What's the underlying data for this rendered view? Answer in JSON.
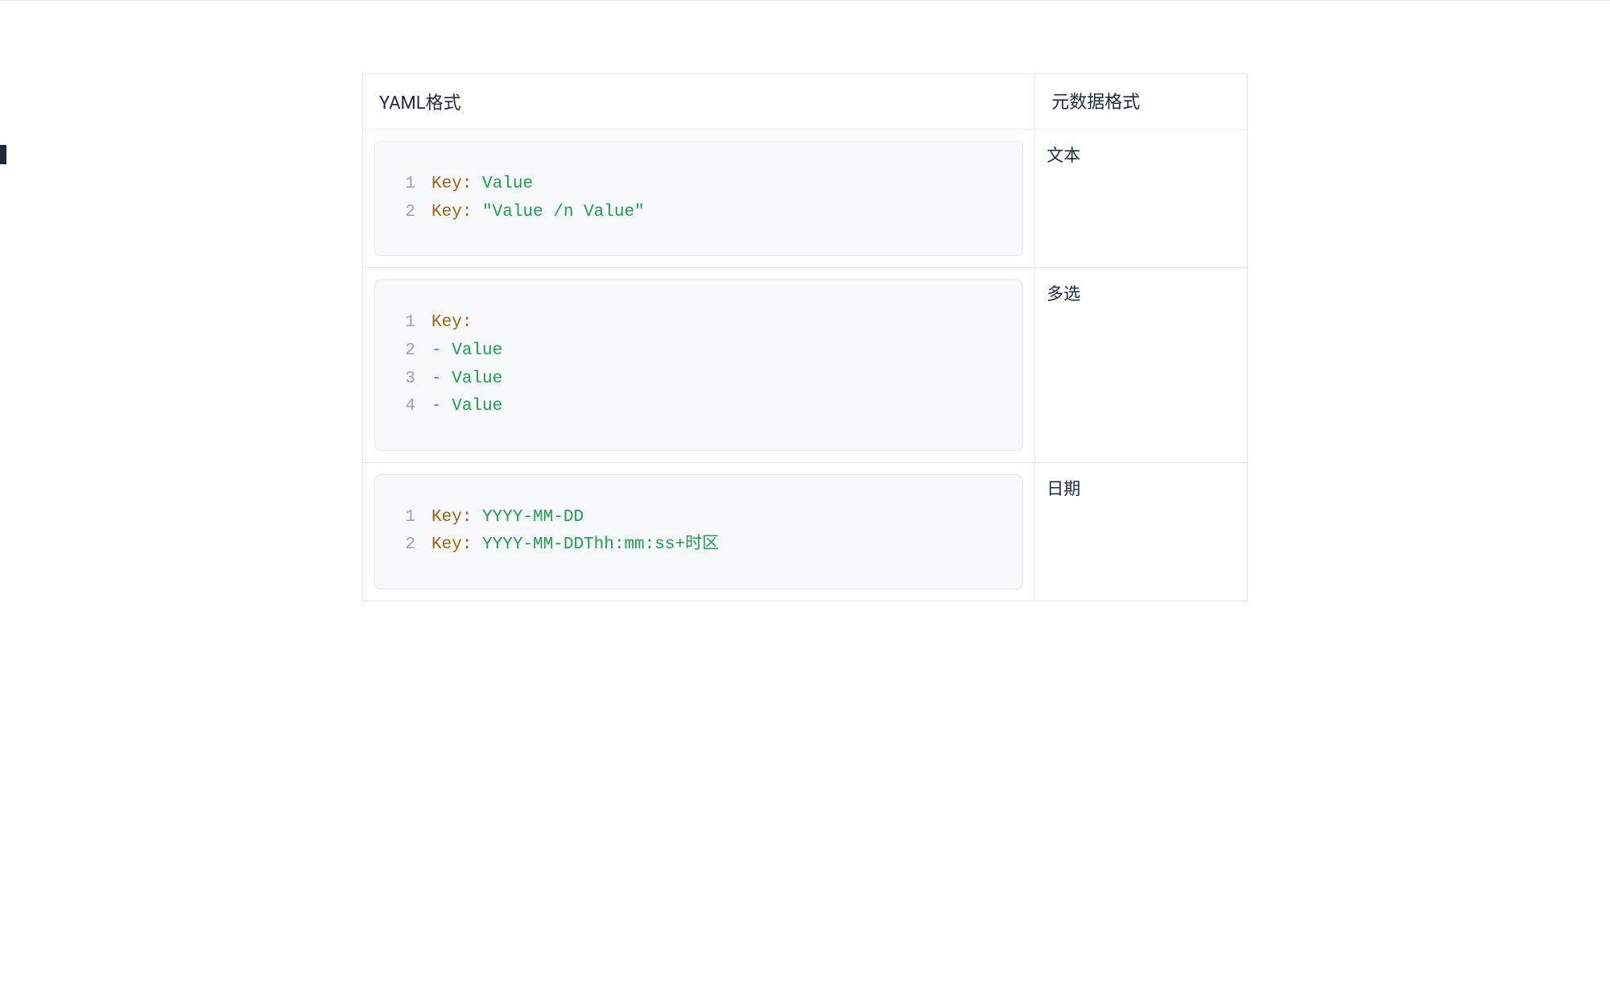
{
  "table": {
    "headers": {
      "yaml": "YAML格式",
      "meta": "元数据格式"
    },
    "rows": [
      {
        "meta_label": "文本",
        "code": [
          {
            "n": "1",
            "tokens": [
              [
                "key",
                "Key"
              ],
              [
                "colon",
                ": "
              ],
              [
                "value",
                "Value"
              ]
            ]
          },
          {
            "n": "2",
            "tokens": [
              [
                "key",
                "Key"
              ],
              [
                "colon",
                ": "
              ],
              [
                "string",
                "\"Value /n Value\""
              ]
            ]
          }
        ]
      },
      {
        "meta_label": "多选",
        "code": [
          {
            "n": "1",
            "tokens": [
              [
                "key",
                "Key"
              ],
              [
                "colon",
                ":"
              ]
            ]
          },
          {
            "n": "2",
            "tokens": [
              [
                "dash",
                "- "
              ],
              [
                "value",
                "Value"
              ]
            ]
          },
          {
            "n": "3",
            "tokens": [
              [
                "dash",
                "- "
              ],
              [
                "value",
                "Value"
              ]
            ]
          },
          {
            "n": "4",
            "tokens": [
              [
                "dash",
                "- "
              ],
              [
                "value",
                "Value"
              ]
            ]
          }
        ]
      },
      {
        "meta_label": "日期",
        "code": [
          {
            "n": "1",
            "tokens": [
              [
                "key",
                "Key"
              ],
              [
                "colon",
                ": "
              ],
              [
                "value",
                "YYYY-MM-DD"
              ]
            ]
          },
          {
            "n": "2",
            "tokens": [
              [
                "key",
                "Key"
              ],
              [
                "colon",
                ": "
              ],
              [
                "value",
                "YYYY-MM-DDThh:mm:ss+时区"
              ]
            ]
          }
        ]
      }
    ]
  }
}
